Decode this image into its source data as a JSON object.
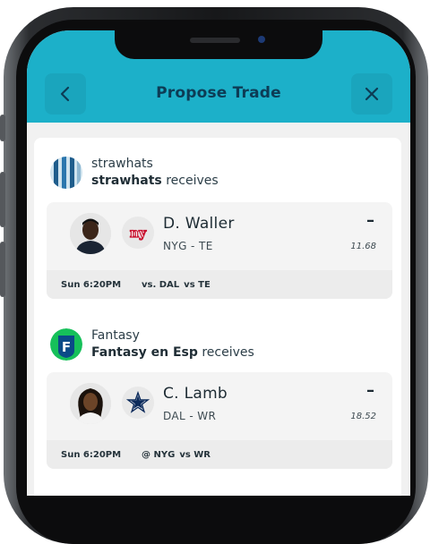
{
  "header": {
    "title": "Propose Trade",
    "accent_color": "#1cb0c9",
    "back_icon": "chevron-left-icon",
    "close_icon": "close-icon"
  },
  "trades": [
    {
      "team_name": "strawhats",
      "receives_team": "strawhats",
      "receives_suffix": " receives",
      "avatar": "striped-team-avatar",
      "player": {
        "name": "D. Waller",
        "team_pos": "NYG - TE",
        "rank": "–",
        "points": "11.68",
        "team_logo": "giants-logo",
        "game_time": "Sun 6:20PM",
        "matchup": "vs. DAL",
        "opp_rank": "vs TE"
      }
    },
    {
      "team_name": "Fantasy",
      "receives_team": "Fantasy en Esp",
      "receives_suffix": " receives",
      "avatar": "fantasy-f-avatar",
      "player": {
        "name": "C. Lamb",
        "team_pos": "DAL - WR",
        "rank": "–",
        "points": "18.52",
        "team_logo": "cowboys-star-logo",
        "game_time": "Sun 6:20PM",
        "matchup": "@ NYG",
        "opp_rank": "vs WR"
      }
    }
  ]
}
